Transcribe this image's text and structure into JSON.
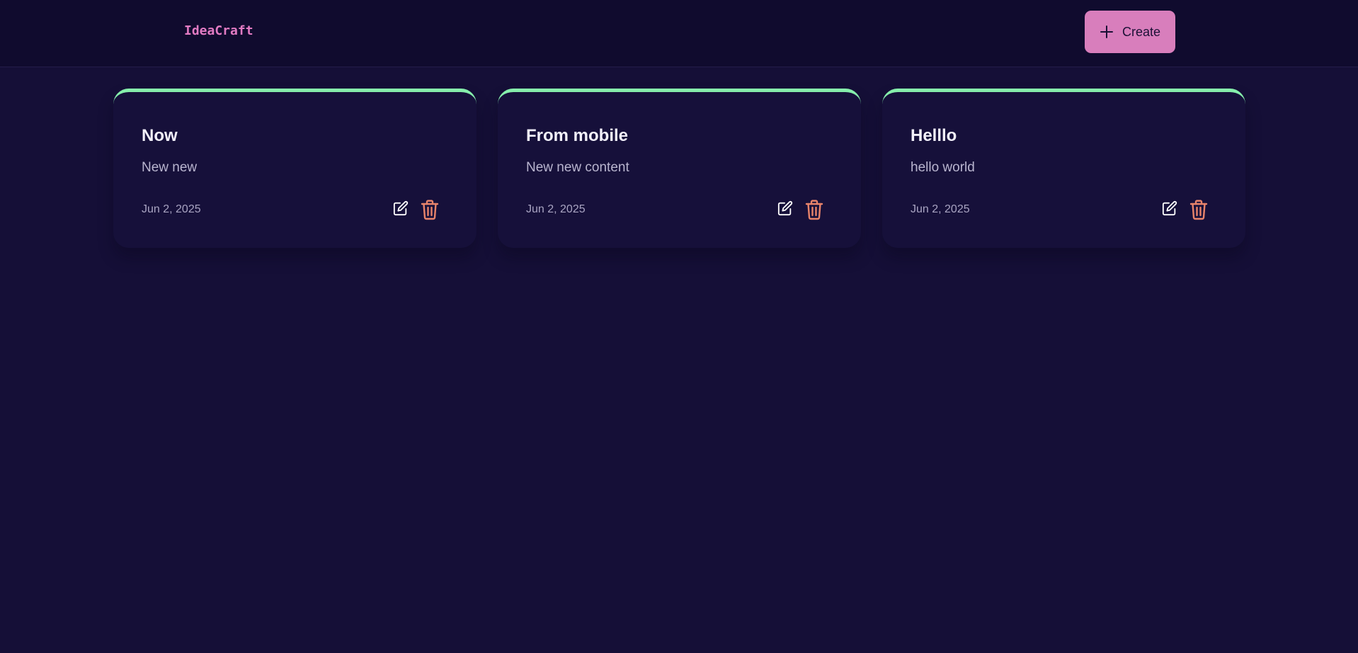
{
  "header": {
    "brand": "IdeaCraft",
    "create_label": "Create"
  },
  "colors": {
    "brand": "#e27bc3",
    "create_bg": "#d87ebc",
    "card_accent": "#86efac",
    "delete": "#e8846b",
    "background": "#150f37"
  },
  "icons": {
    "create": "plus-icon",
    "edit": "edit-icon",
    "delete": "trash-icon"
  },
  "notes": [
    {
      "title": "Now",
      "content": "New new",
      "date": "Jun 2, 2025"
    },
    {
      "title": "From mobile",
      "content": "New new content",
      "date": "Jun 2, 2025"
    },
    {
      "title": "Helllo",
      "content": "hello world",
      "date": "Jun 2, 2025"
    }
  ]
}
